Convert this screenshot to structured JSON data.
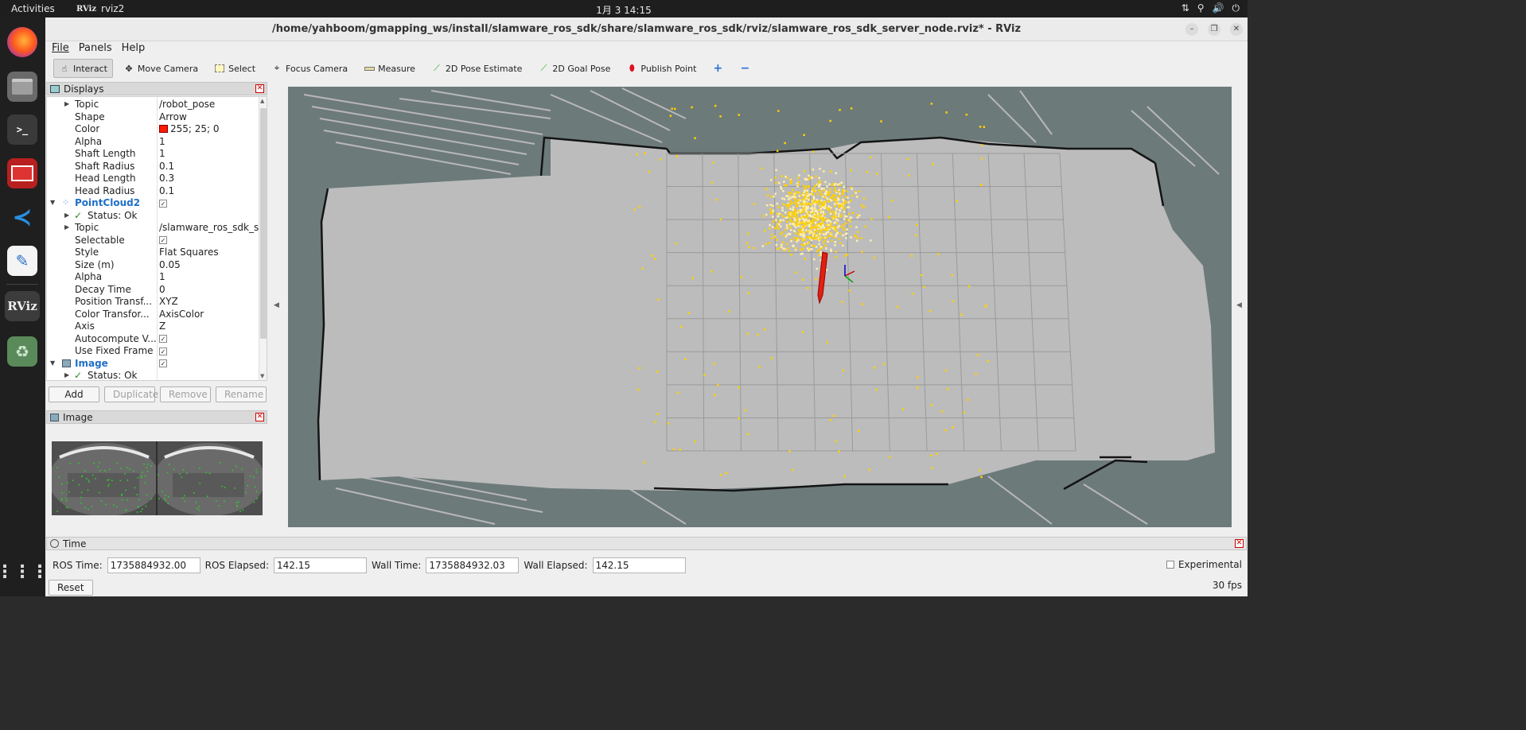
{
  "topbar": {
    "activities": "Activities",
    "app_icon_text": "RViz",
    "app_name": "rviz2",
    "clock": "1月 3  14:15"
  },
  "dock": {
    "items": [
      "firefox-icon",
      "files-icon",
      "terminal-icon",
      "app-red-icon",
      "vscode-icon",
      "text-editor-icon",
      "rviz-icon",
      "trash-icon",
      "show-apps-icon"
    ],
    "rviz_label": "RViz"
  },
  "window": {
    "title": "/home/yahboom/gmapping_ws/install/slamware_ros_sdk/share/slamware_ros_sdk/rviz/slamware_ros_sdk_server_node.rviz* - RViz"
  },
  "menu": {
    "file": "File",
    "panels": "Panels",
    "help": "Help"
  },
  "toolbar": {
    "interact": "Interact",
    "move_camera": "Move Camera",
    "select": "Select",
    "focus_camera": "Focus Camera",
    "measure": "Measure",
    "pose_estimate": "2D Pose Estimate",
    "goal_pose": "2D Goal Pose",
    "publish_point": "Publish Point"
  },
  "displays": {
    "title": "Displays",
    "rows": [
      {
        "name": "Topic",
        "value": "/robot_pose"
      },
      {
        "name": "Shape",
        "value": "Arrow"
      },
      {
        "name": "Color",
        "value": "255; 25; 0"
      },
      {
        "name": "Alpha",
        "value": "1"
      },
      {
        "name": "Shaft Length",
        "value": "1"
      },
      {
        "name": "Shaft Radius",
        "value": "0.1"
      },
      {
        "name": "Head Length",
        "value": "0.3"
      },
      {
        "name": "Head Radius",
        "value": "0.1"
      },
      {
        "name": "PointCloud2",
        "value": ""
      },
      {
        "name": "Status: Ok",
        "value": ""
      },
      {
        "name": "Topic",
        "value": "/slamware_ros_sdk_s..."
      },
      {
        "name": "Selectable",
        "value": ""
      },
      {
        "name": "Style",
        "value": "Flat Squares"
      },
      {
        "name": "Size (m)",
        "value": "0.05"
      },
      {
        "name": "Alpha",
        "value": "1"
      },
      {
        "name": "Decay Time",
        "value": "0"
      },
      {
        "name": "Position Transf...",
        "value": "XYZ"
      },
      {
        "name": "Color Transfor...",
        "value": "AxisColor"
      },
      {
        "name": "Axis",
        "value": "Z"
      },
      {
        "name": "Autocompute V...",
        "value": ""
      },
      {
        "name": "Use Fixed Frame",
        "value": ""
      },
      {
        "name": "Image",
        "value": ""
      },
      {
        "name": "Status: Ok",
        "value": ""
      }
    ],
    "color_swatch": "#ff1900",
    "buttons": {
      "add": "Add",
      "duplicate": "Duplicate",
      "remove": "Remove",
      "rename": "Rename"
    }
  },
  "image_panel": {
    "title": "Image"
  },
  "time_panel": {
    "title": "Time",
    "ros_time_label": "ROS Time:",
    "ros_time": "1735884932.00",
    "ros_elapsed_label": "ROS Elapsed:",
    "ros_elapsed": "142.15",
    "wall_time_label": "Wall Time:",
    "wall_time": "1735884932.03",
    "wall_elapsed_label": "Wall Elapsed:",
    "wall_elapsed": "142.15",
    "experimental": "Experimental",
    "reset": "Reset",
    "fps": "30 fps"
  },
  "colors": {
    "map_free": "#bcbcbc",
    "map_unknown": "#6d7a7a",
    "point_yellow": "#ffd000",
    "point_cream": "#ffeeb0",
    "pose_arrow": "#e02010",
    "grid": "#9a9a9a"
  }
}
